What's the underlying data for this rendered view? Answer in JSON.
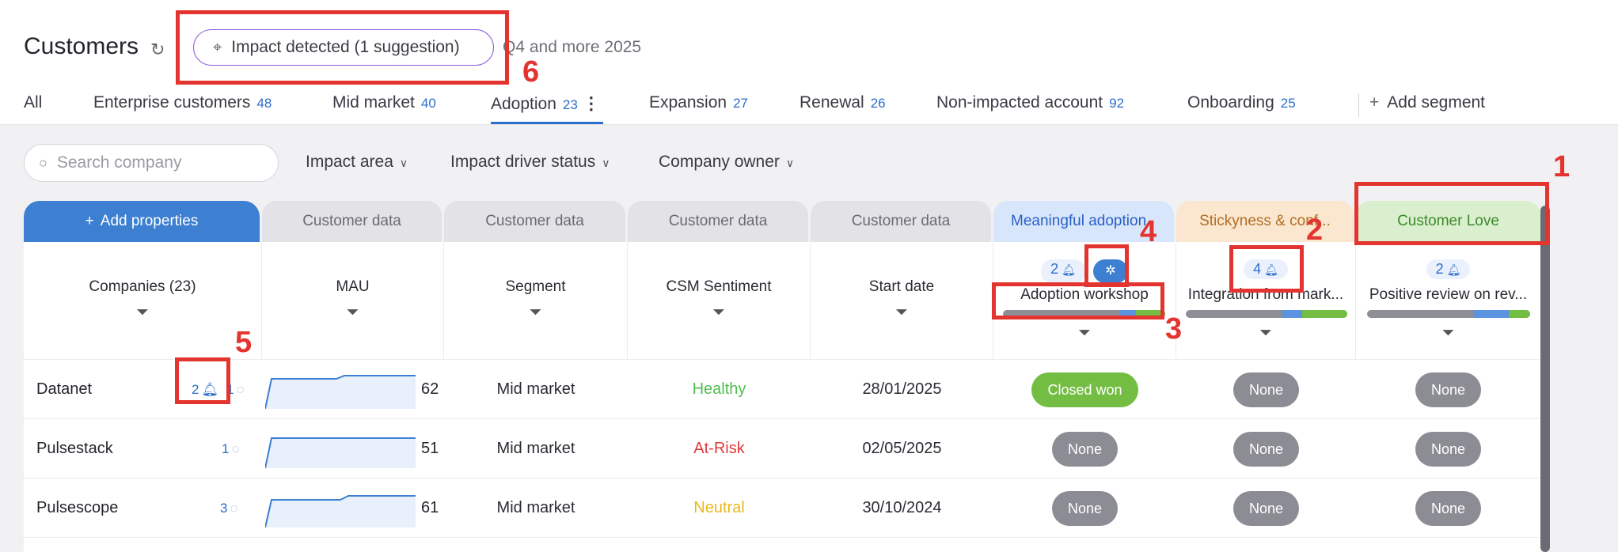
{
  "page": {
    "title": "Customers",
    "impact_button": "Impact detected (1 suggestion)",
    "period": "Q4 and more 2025"
  },
  "icons": {
    "refresh": "refresh-icon",
    "crosshair": "crosshair-icon",
    "search": "search-icon",
    "chevron": "chevron-down-icon",
    "funnel": "funnel-icon",
    "bell": "bell-icon",
    "bulb": "lightbulb-icon",
    "kebab": "kebab-icon",
    "plus": "plus-icon"
  },
  "tabs": [
    {
      "label": "All",
      "count": ""
    },
    {
      "label": "Enterprise customers",
      "count": "48"
    },
    {
      "label": "Mid market",
      "count": "40"
    },
    {
      "label": "Adoption",
      "count": "23"
    },
    {
      "label": "Expansion",
      "count": "27"
    },
    {
      "label": "Renewal",
      "count": "26"
    },
    {
      "label": "Non-impacted account",
      "count": "92"
    },
    {
      "label": "Onboarding",
      "count": "25"
    }
  ],
  "add_segment": "Add segment",
  "search": {
    "placeholder": "Search company"
  },
  "filters": [
    "Impact area",
    "Impact driver status",
    "Company owner"
  ],
  "groups": {
    "add_properties": "Add properties",
    "customer_data": "Customer data",
    "impact1": "Meaningful adoption",
    "impact2": "Stickyness & conf...",
    "impact3": "Customer Love"
  },
  "columns": {
    "companies": "Companies (23)",
    "mau": "MAU",
    "segment": "Segment",
    "csm": "CSM Sentiment",
    "start": "Start date"
  },
  "impact_cols": [
    {
      "count": "2",
      "label": "Adoption workshop",
      "progress": [
        0.72,
        0.1,
        0.18
      ]
    },
    {
      "count": "4",
      "label": "Integration from mark...",
      "progress": [
        0.6,
        0.12,
        0.28
      ]
    },
    {
      "count": "2",
      "label": "Positive review on rev...",
      "progress": [
        0.65,
        0.22,
        0.13
      ]
    }
  ],
  "colors": {
    "accent": "#2c6ecb",
    "healthy": "#4fbf4f",
    "at_risk": "#e03a3a",
    "neutral": "#e9b81f",
    "won": "#74bd43",
    "none": "#8c8c94",
    "progress_blue": "#5b93e0",
    "progress_green": "#74bd43"
  },
  "rows": [
    {
      "company": "Datanet",
      "meta1": "2",
      "meta2": "1",
      "mau": "62",
      "segment": "Mid market",
      "sentiment": "Healthy",
      "sentiment_color": "#4fbf4f",
      "start": "28/01/2025",
      "s1": "Closed won",
      "s2": "None",
      "s3": "None"
    },
    {
      "company": "Pulsestack",
      "meta1": "",
      "meta2": "1",
      "mau": "51",
      "segment": "Mid market",
      "sentiment": "At-Risk",
      "sentiment_color": "#e03a3a",
      "start": "02/05/2025",
      "s1": "None",
      "s2": "None",
      "s3": "None"
    },
    {
      "company": "Pulsescope",
      "meta1": "",
      "meta2": "3",
      "mau": "61",
      "segment": "Mid market",
      "sentiment": "Neutral",
      "sentiment_color": "#e9b81f",
      "start": "30/10/2024",
      "s1": "None",
      "s2": "None",
      "s3": "None"
    }
  ],
  "annotations": [
    "1",
    "2",
    "3",
    "4",
    "5",
    "6"
  ]
}
